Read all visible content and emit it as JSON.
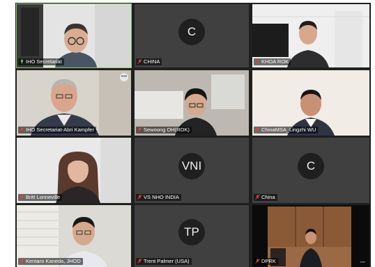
{
  "participants": [
    {
      "name": "IHO Secretariat",
      "mic": "on"
    },
    {
      "name": "CHINA",
      "mic": "muted",
      "initials": "C"
    },
    {
      "name": "KHOA ROK",
      "mic": "muted"
    },
    {
      "name": "IHO Secretariat-Abri Kampfer",
      "mic": "muted"
    },
    {
      "name": "Sewoong OH(ROK)",
      "mic": "muted"
    },
    {
      "name": "ChinaMSA_Lingzhi WU",
      "mic": "muted"
    },
    {
      "name": "Britt Lonneville",
      "mic": "muted"
    },
    {
      "name": "VS NHO INDIA",
      "mic": "muted",
      "initials": "VNI"
    },
    {
      "name": "China",
      "mic": "muted",
      "initials": "C"
    },
    {
      "name": "Kentaro Kaneda, JHOD",
      "mic": "muted"
    },
    {
      "name": "Trent Palmer (USA)",
      "mic": "muted",
      "initials": "TP"
    },
    {
      "name": "DPRK",
      "mic": "muted"
    }
  ],
  "icons": {
    "more_options": "more-options-icon",
    "mic_on": "mic-icon",
    "mic_muted": "mic-muted-icon"
  },
  "colors": {
    "tile_bg": "#404040",
    "grid_bg": "#1f1f1f",
    "active_speaker": "#8ccf6a",
    "muted_mic": "#e0443e",
    "live_mic": "#6fd05a"
  }
}
